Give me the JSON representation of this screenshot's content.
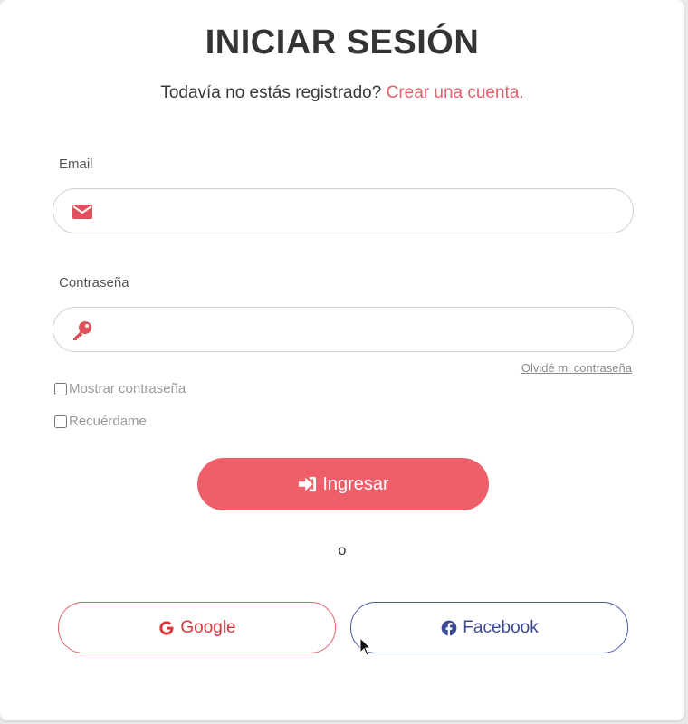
{
  "header": {
    "title": "INICIAR SESIÓN",
    "subtitle_prefix": "Todavía no estás registrado?",
    "create_account_link": "Crear una cuenta."
  },
  "form": {
    "email_label": "Email",
    "email_value": "",
    "email_icon": "envelope-icon",
    "password_label": "Contraseña",
    "password_value": "",
    "password_icon": "key-icon",
    "forgot_password": "Olvidé mi contraseña",
    "show_password_label": "Mostrar contraseña",
    "show_password_checked": false,
    "remember_me_label": "Recuérdame",
    "remember_me_checked": false,
    "submit_label": "Ingresar",
    "submit_icon": "sign-in-icon"
  },
  "divider": {
    "text": "o"
  },
  "social": {
    "google_label": "Google",
    "google_icon": "google-icon",
    "facebook_label": "Facebook",
    "facebook_icon": "facebook-icon"
  },
  "colors": {
    "accent": "#ee5f6a",
    "link": "#e0616c",
    "google": "#d9363e",
    "facebook": "#3c4a95"
  }
}
